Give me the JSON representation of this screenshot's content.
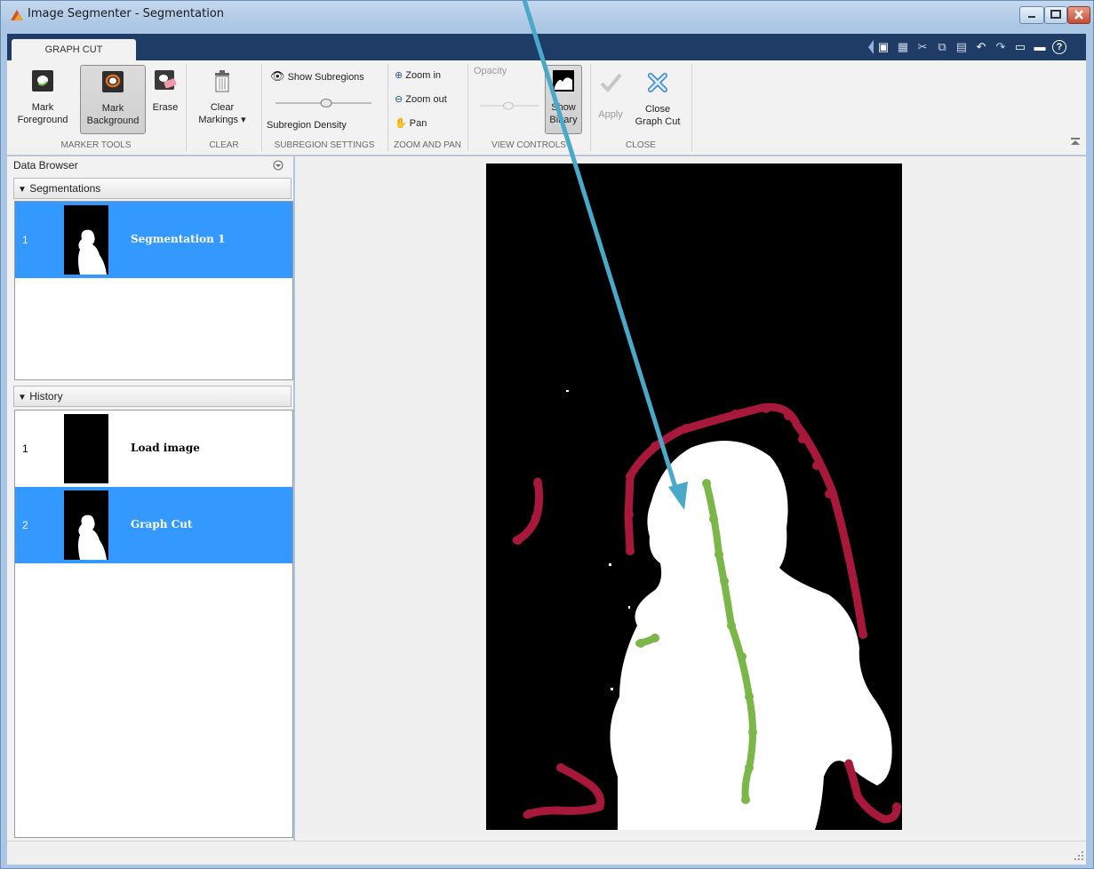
{
  "window": {
    "title": "Image Segmenter - Segmentation"
  },
  "tabs": [
    {
      "label": "GRAPH CUT"
    }
  ],
  "ribbon": {
    "marker_tools": {
      "section_label": "MARKER TOOLS",
      "mark_foreground": "Mark\nForeground",
      "mark_foreground_l1": "Mark",
      "mark_foreground_l2": "Foreground",
      "mark_background_l1": "Mark",
      "mark_background_l2": "Background",
      "erase": "Erase"
    },
    "clear": {
      "section_label": "CLEAR",
      "clear_markings_l1": "Clear",
      "clear_markings_l2": "Markings"
    },
    "subregion_settings": {
      "section_label": "SUBREGION SETTINGS",
      "show_subregions": "Show Subregions",
      "subregion_density": "Subregion Density"
    },
    "zoom_and_pan": {
      "section_label": "ZOOM AND PAN",
      "zoom_in": "Zoom in",
      "zoom_out": "Zoom out",
      "pan": "Pan"
    },
    "view_controls": {
      "section_label": "VIEW CONTROLS",
      "opacity": "Opacity",
      "show_binary_l1": "Show",
      "show_binary_l2": "Binary"
    },
    "close": {
      "section_label": "CLOSE",
      "apply": "Apply",
      "close_graph_cut_l1": "Close",
      "close_graph_cut_l2": "Graph Cut"
    }
  },
  "data_browser": {
    "title": "Data Browser",
    "segmentations": {
      "header": "Segmentations",
      "items": [
        {
          "index": "1",
          "label": "Segmentation 1",
          "selected": true
        }
      ]
    },
    "history": {
      "header": "History",
      "items": [
        {
          "index": "1",
          "label": "Load image",
          "selected": false
        },
        {
          "index": "2",
          "label": "Graph Cut",
          "selected": true
        }
      ]
    }
  },
  "colors": {
    "foreground_marker": "#7ab648",
    "background_marker": "#a8183a",
    "annotation_arrow": "#4aa8c8",
    "selection": "#3399ff"
  }
}
